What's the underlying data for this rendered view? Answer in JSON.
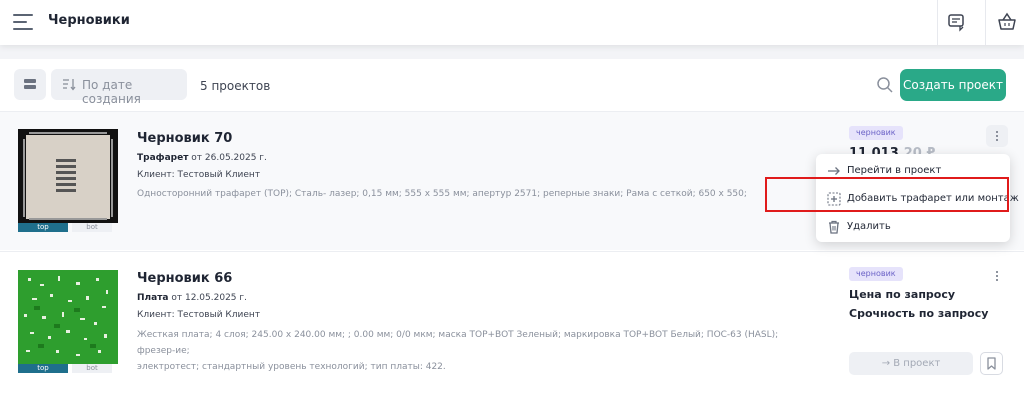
{
  "header": {
    "title": "Черновики",
    "icons": [
      "menu-icon",
      "chat-icon",
      "basket-icon"
    ]
  },
  "toolbar": {
    "sort_label": "По дате создания",
    "count": "5 проектов",
    "create_label": "Создать проект",
    "accent": "#2aa988"
  },
  "cards": [
    {
      "title": "Черновик 70",
      "type": "Трафарет",
      "date": "от 26.05.2025 г.",
      "client": "Клиент: Тестовый Клиент",
      "description": "Односторонний трафарет (TOP); Сталь- лазер; 0,15 мм; 555 x 555 мм; апертур 2571; реперные знаки; Рама с сеткой; 650 x 550;",
      "badge": "черновик",
      "price_main": "11 013",
      "price_frac": ",20 ₽",
      "thumb_tags": [
        "top",
        "bot"
      ]
    },
    {
      "title": "Черновик 66",
      "type": "Плата",
      "date": "от 12.05.2025 г.",
      "client": "Клиент: Тестовый Клиент",
      "description_line1": "Жесткая плата; 4 слоя; 245.00 x 240.00 мм; ; 0.00 мм; 0/0 мкм; маска TOP+BOT Зеленый; маркировка TOP+BOT Белый; ПОС-63 (HASL); фрезер-ие;",
      "description_line2": "электротест; стандартный уровень технологий; тип платы: 422.",
      "badge": "черновик",
      "price_label": "Цена по запросу",
      "urgency_label": "Срочность по запросу",
      "to_project_label": "→ В проект",
      "thumb_tags": [
        "top",
        "bot"
      ]
    }
  ],
  "menu": {
    "items": [
      {
        "label": "Перейти в проект",
        "icon": "arrow-right-icon"
      },
      {
        "label": "Добавить трафарет или монтаж",
        "icon": "add-box-icon"
      },
      {
        "label": "Удалить",
        "icon": "trash-icon"
      }
    ],
    "highlight_color": "#e01b1b"
  }
}
